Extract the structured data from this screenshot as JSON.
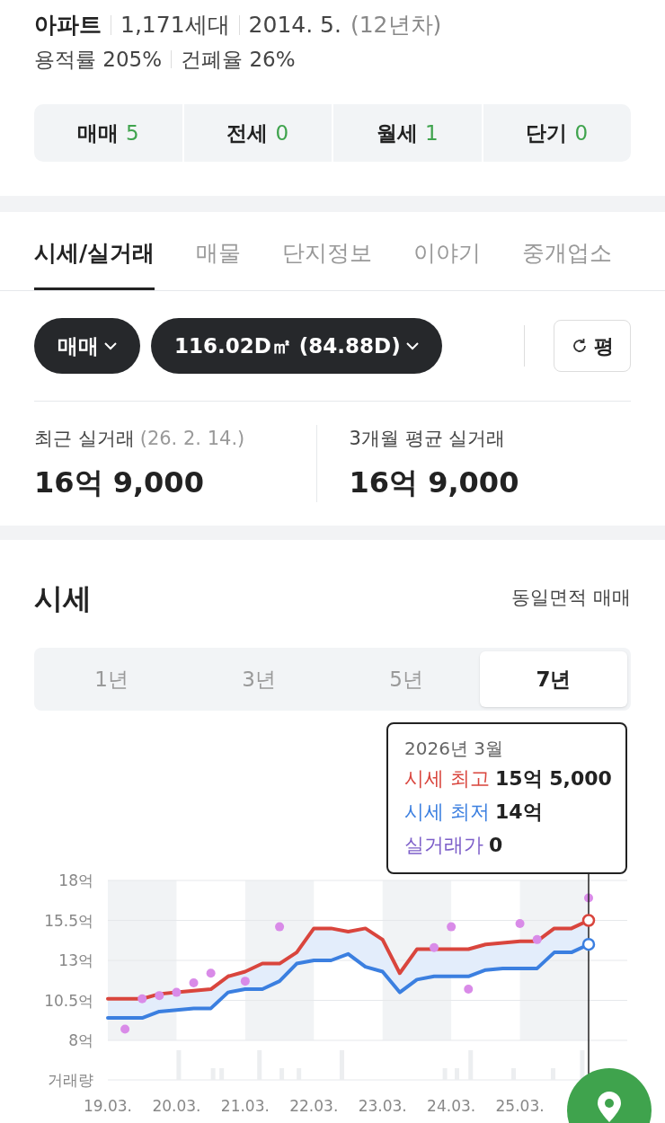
{
  "summary": {
    "type": "아파트",
    "households": "1,171세대",
    "built": "2014. 5.",
    "age": "(12년차)",
    "far": "용적률 205%",
    "bcr": "건폐율 26%"
  },
  "listing_counts": [
    {
      "label": "매매",
      "count": "5"
    },
    {
      "label": "전세",
      "count": "0"
    },
    {
      "label": "월세",
      "count": "1"
    },
    {
      "label": "단기",
      "count": "0"
    }
  ],
  "tabs": [
    {
      "label": "시세/실거래",
      "selected": true
    },
    {
      "label": "매물",
      "selected": false
    },
    {
      "label": "단지정보",
      "selected": false
    },
    {
      "label": "이야기",
      "selected": false
    },
    {
      "label": "중개업소",
      "selected": false
    }
  ],
  "filters": [
    {
      "label": "매매"
    },
    {
      "label": "116.02D㎡ (84.88D)"
    }
  ],
  "unit_button": "평",
  "stats": [
    {
      "label": "최근 실거래",
      "date": "(26. 2. 14.)",
      "value": "16억 9,000"
    },
    {
      "label": "3개월 평균 실거래",
      "value": "16억 9,000"
    }
  ],
  "price_section": {
    "title": "시세",
    "subtitle": "동일면적 매매",
    "periods": [
      {
        "label": "1년",
        "selected": false
      },
      {
        "label": "3년",
        "selected": false
      },
      {
        "label": "5년",
        "selected": false
      },
      {
        "label": "7년",
        "selected": true
      }
    ],
    "tooltip": {
      "title": "2026년 3월",
      "rows": [
        {
          "value": "15억 5,000",
          "color": "#d9453d"
        },
        {
          "value": "14억",
          "color": "#3b7fe0"
        },
        {
          "value": "0",
          "color": "#7d5fc9"
        }
      ]
    },
    "volume_label": "거래량",
    "chart_data": {
      "type": "line",
      "grid": true,
      "yticks": [
        {
          "value": 8,
          "label": "8억"
        },
        {
          "value": 10.5,
          "label": "10.5억"
        },
        {
          "value": 13,
          "label": "13억"
        },
        {
          "value": 15.5,
          "label": "15.5억"
        },
        {
          "value": 18,
          "label": "18억"
        }
      ],
      "ylim": [
        8,
        18
      ],
      "categories": [
        "19.03.",
        null,
        null,
        null,
        "20.03.",
        null,
        null,
        null,
        "21.03.",
        null,
        null,
        null,
        "22.03.",
        null,
        null,
        null,
        "23.03.",
        null,
        null,
        null,
        "24.03.",
        null,
        null,
        null,
        "25.03.",
        null,
        null,
        null,
        null
      ],
      "series": [
        {
          "name": "시세 최고",
          "color": "#d9453d",
          "values": [
            10.6,
            10.6,
            10.6,
            10.9,
            11.0,
            11.1,
            11.2,
            12.0,
            12.3,
            12.8,
            12.8,
            13.5,
            15.0,
            15.0,
            14.8,
            15.0,
            14.3,
            12.2,
            13.7,
            13.7,
            13.7,
            13.7,
            14.0,
            14.1,
            14.2,
            14.2,
            15.0,
            15.0,
            15.5
          ]
        },
        {
          "name": "시세 최저",
          "color": "#3b7fe0",
          "values": [
            9.4,
            9.4,
            9.4,
            9.8,
            9.9,
            10.0,
            10.0,
            11.0,
            11.2,
            11.2,
            11.7,
            12.8,
            13.0,
            13.0,
            13.4,
            12.6,
            12.3,
            11.0,
            11.8,
            12.0,
            12.0,
            12.0,
            12.4,
            12.5,
            12.5,
            12.5,
            13.5,
            13.5,
            14.0
          ]
        },
        {
          "name": "실거래가",
          "type": "scatter",
          "color": "#d98be8",
          "values": [
            null,
            8.7,
            10.6,
            10.8,
            11.0,
            11.6,
            12.2,
            null,
            11.7,
            null,
            15.1,
            null,
            null,
            null,
            null,
            null,
            null,
            null,
            null,
            13.8,
            15.1,
            11.2,
            null,
            null,
            15.3,
            14.3,
            null,
            null,
            16.9
          ]
        }
      ]
    }
  }
}
